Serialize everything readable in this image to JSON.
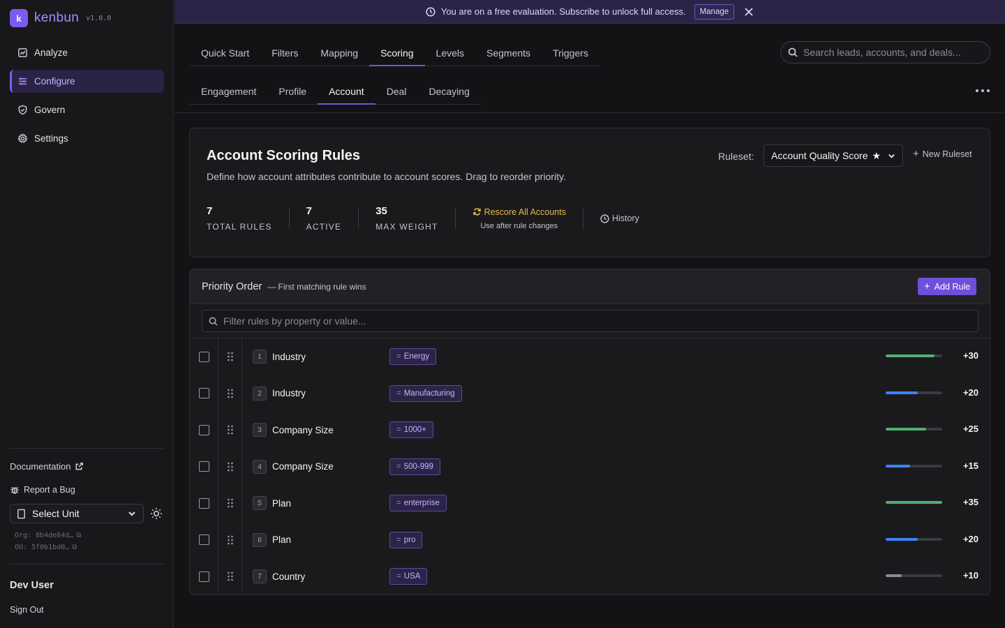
{
  "brand": {
    "name": "kenbun",
    "version": "v1.0.0",
    "logo_letter": "k"
  },
  "sidebar": {
    "items": [
      {
        "label": "Analyze",
        "icon": "chart-icon",
        "active": false
      },
      {
        "label": "Configure",
        "icon": "sliders-icon",
        "active": true
      },
      {
        "label": "Govern",
        "icon": "shield-icon",
        "active": false
      },
      {
        "label": "Settings",
        "icon": "gear-icon",
        "active": false
      }
    ],
    "documentation": "Documentation",
    "report_bug": "Report a Bug",
    "unit_select": "Select Unit",
    "org_id": "Org: 8b4de64d…",
    "ou_id": "OU: 5f0b1bd0…",
    "user_name": "Dev User",
    "sign_out": "Sign Out"
  },
  "banner": {
    "text": "You are on a free evaluation. Subscribe to unlock full access.",
    "manage": "Manage"
  },
  "tabs_primary": [
    "Quick Start",
    "Filters",
    "Mapping",
    "Scoring",
    "Levels",
    "Segments",
    "Triggers"
  ],
  "tabs_primary_active": 3,
  "tabs_secondary": [
    "Engagement",
    "Profile",
    "Account",
    "Deal",
    "Decaying"
  ],
  "tabs_secondary_active": 2,
  "search": {
    "placeholder": "Search leads, accounts, and deals..."
  },
  "rules_card": {
    "title": "Account Scoring Rules",
    "subtitle": "Define how account attributes contribute to account scores. Drag to reorder priority.",
    "ruleset_label": "Ruleset:",
    "ruleset_value": "Account Quality Score",
    "new_ruleset": "New Ruleset",
    "stats": {
      "total_rules": {
        "value": "7",
        "label": "TOTAL RULES"
      },
      "active": {
        "value": "7",
        "label": "ACTIVE"
      },
      "max_weight": {
        "value": "35",
        "label": "MAX WEIGHT"
      }
    },
    "rescore": {
      "label": "Rescore All Accounts",
      "hint": "Use after rule changes"
    },
    "history": "History"
  },
  "priority": {
    "title": "Priority Order",
    "subtitle": "— First matching rule wins",
    "add_rule": "Add Rule",
    "filter_placeholder": "Filter rules by property or value...",
    "rules": [
      {
        "num": "1",
        "property": "Industry",
        "op": "=",
        "value": "Energy",
        "weight": "+30",
        "level": 0.86,
        "color": "#4faf72"
      },
      {
        "num": "2",
        "property": "Industry",
        "op": "=",
        "value": "Manufacturing",
        "weight": "+20",
        "level": 0.57,
        "color": "#3b82f6"
      },
      {
        "num": "3",
        "property": "Company Size",
        "op": "=",
        "value": "1000+",
        "weight": "+25",
        "level": 0.71,
        "color": "#4faf72"
      },
      {
        "num": "4",
        "property": "Company Size",
        "op": "=",
        "value": "500-999",
        "weight": "+15",
        "level": 0.43,
        "color": "#3b82f6"
      },
      {
        "num": "5",
        "property": "Plan",
        "op": "=",
        "value": "enterprise",
        "weight": "+35",
        "level": 1.0,
        "color": "#4faf72"
      },
      {
        "num": "6",
        "property": "Plan",
        "op": "=",
        "value": "pro",
        "weight": "+20",
        "level": 0.57,
        "color": "#3b82f6"
      },
      {
        "num": "7",
        "property": "Country",
        "op": "=",
        "value": "USA",
        "weight": "+10",
        "level": 0.29,
        "color": "#8b8b93"
      }
    ]
  }
}
